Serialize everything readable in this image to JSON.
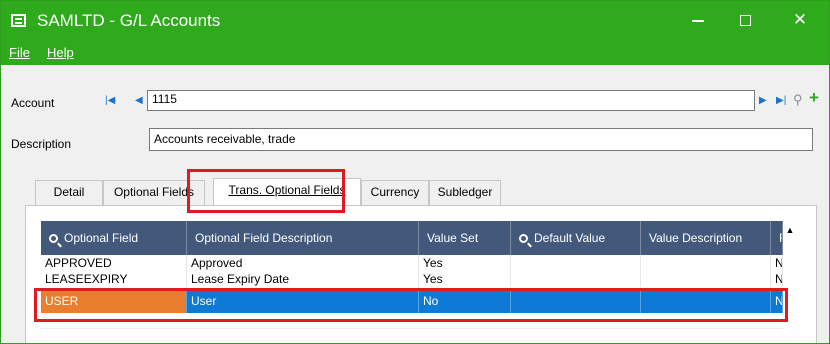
{
  "window": {
    "title": "SAMLTD - G/L Accounts",
    "controls": {
      "minimize": "—",
      "maximize": "□",
      "close": "✕"
    }
  },
  "menu": [
    {
      "label": "File"
    },
    {
      "label": "Help"
    }
  ],
  "account": {
    "label": "Account",
    "value": "1115"
  },
  "description": {
    "label": "Description",
    "value": "Accounts receivable, trade"
  },
  "tabs": [
    {
      "label": "Detail"
    },
    {
      "label": "Optional Fields"
    },
    {
      "label": "Trans. Optional Fields",
      "active": true
    },
    {
      "label": "Currency"
    },
    {
      "label": "Subledger"
    }
  ],
  "grid": {
    "columns": [
      {
        "label": "Optional Field",
        "icon": "search-icon"
      },
      {
        "label": "Optional Field Description"
      },
      {
        "label": "Value Set"
      },
      {
        "label": "Default Value",
        "icon": "search-icon"
      },
      {
        "label": "Value Description"
      },
      {
        "label": "Require"
      }
    ],
    "rows": [
      {
        "field": "APPROVED",
        "description": "Approved",
        "value_set": "Yes",
        "default_value": "",
        "value_description": "",
        "required": "No"
      },
      {
        "field": "LEASEEXPIRY",
        "description": "Lease Expiry Date",
        "value_set": "Yes",
        "default_value": "",
        "value_description": "",
        "required": "No"
      },
      {
        "field": "USER",
        "description": "User",
        "value_set": "No",
        "default_value": "",
        "value_description": "",
        "required": "No",
        "selected": true
      }
    ]
  },
  "colors": {
    "titlebar": "#2eaa1c",
    "grid_header": "#43597c",
    "selected_row": "#0f7ad6",
    "selected_cell": "#ea7e2f",
    "highlight": "#e01a22",
    "nav_arrow": "#1b74c9"
  }
}
